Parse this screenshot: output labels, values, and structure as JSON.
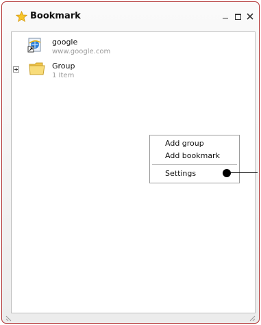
{
  "window": {
    "title": "Bookmark",
    "title_icon": "star-icon",
    "controls": [
      "minimize-icon",
      "maximize-icon",
      "close-icon"
    ],
    "accent_border": "#b03030"
  },
  "bookmarks": [
    {
      "type": "bookmark",
      "icon": "internet-explorer-shortcut-icon",
      "name": "google",
      "url": "www.google.com"
    },
    {
      "type": "group",
      "icon": "folder-icon",
      "expander": "plus-expander-icon",
      "name": "Group",
      "count": "1 Item"
    }
  ],
  "context_menu": {
    "items": [
      {
        "label": "Add group"
      },
      {
        "label": "Add bookmark"
      },
      {
        "label": "Settings"
      }
    ]
  },
  "colors": {
    "content_background": "#ffffff",
    "subtext": "#9a9a9a",
    "folder_yellow": "#f5d55b"
  }
}
